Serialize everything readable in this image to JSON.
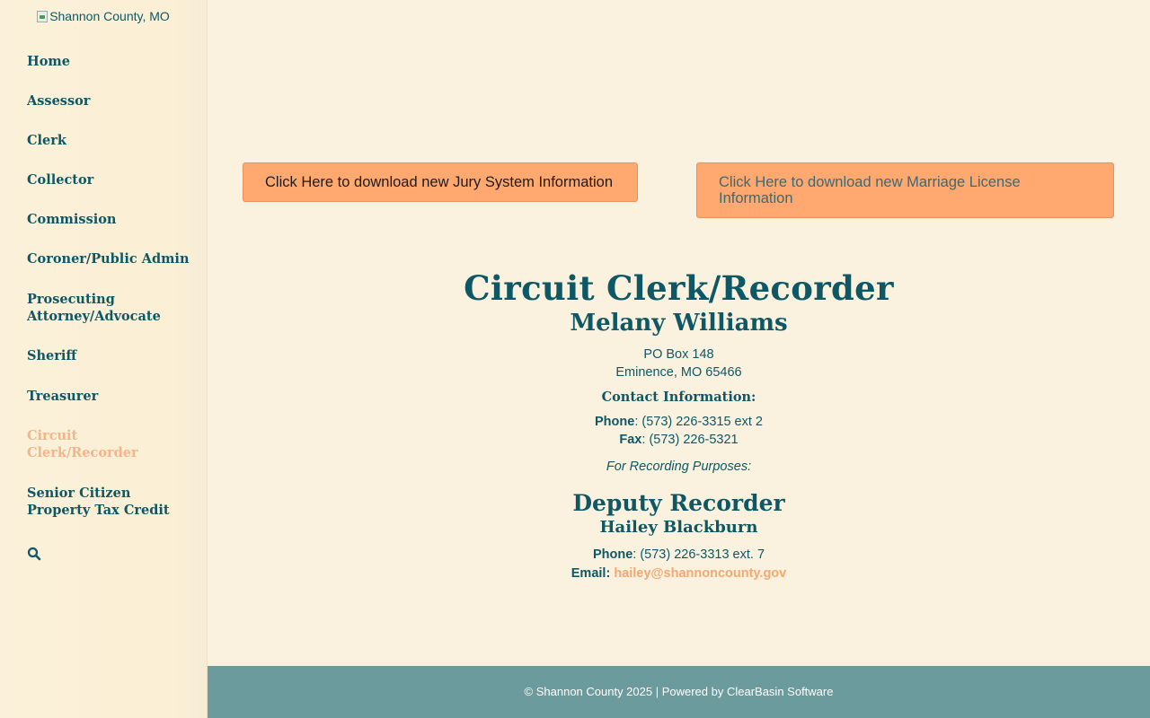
{
  "sidebar": {
    "logo_alt": "Shannon County, MO",
    "nav": [
      {
        "label": "Home"
      },
      {
        "label": "Assessor"
      },
      {
        "label": "Clerk"
      },
      {
        "label": "Collector"
      },
      {
        "label": "Commission"
      },
      {
        "label": "Coroner/Public Admin"
      },
      {
        "label": "Prosecuting Attorney/Advocate"
      },
      {
        "label": "Sheriff"
      },
      {
        "label": "Treasurer"
      },
      {
        "label": "Circuit Clerk/Recorder",
        "active": true
      },
      {
        "label": "Senior Citizen Property Tax Credit"
      }
    ],
    "search_icon": "search-icon"
  },
  "buttons": {
    "jury": "Click Here to download new Jury System Information",
    "marriage": "Click Here to download new Marriage License Information"
  },
  "office": {
    "title": "Circuit Clerk/Recorder",
    "name": "Melany Williams",
    "address_line1": "PO Box 148",
    "address_line2": "Eminence, MO 65466",
    "contact_heading": "Contact Information:",
    "phone_label": "Phone",
    "phone": ": (573) 226-3315 ext 2",
    "fax_label": "Fax",
    "fax": ": (573) 226-5321",
    "recording_note": "For Recording Purposes:"
  },
  "deputy": {
    "title": "Deputy Recorder",
    "name": "Hailey Blackburn",
    "phone_label": "Phone",
    "phone": ": (573) 226-3313 ext. 7",
    "email_label": "Email:",
    "email": "hailey@shannoncounty.gov"
  },
  "footer": {
    "text": "© Shannon County 2025 | Powered by ClearBasin Software"
  },
  "colors": {
    "background": "#faf1de",
    "primary_text": "#0e5866",
    "accent": "#ffa86f",
    "active_nav": "#f5b48a",
    "footer_bg": "#6b9b9c"
  }
}
